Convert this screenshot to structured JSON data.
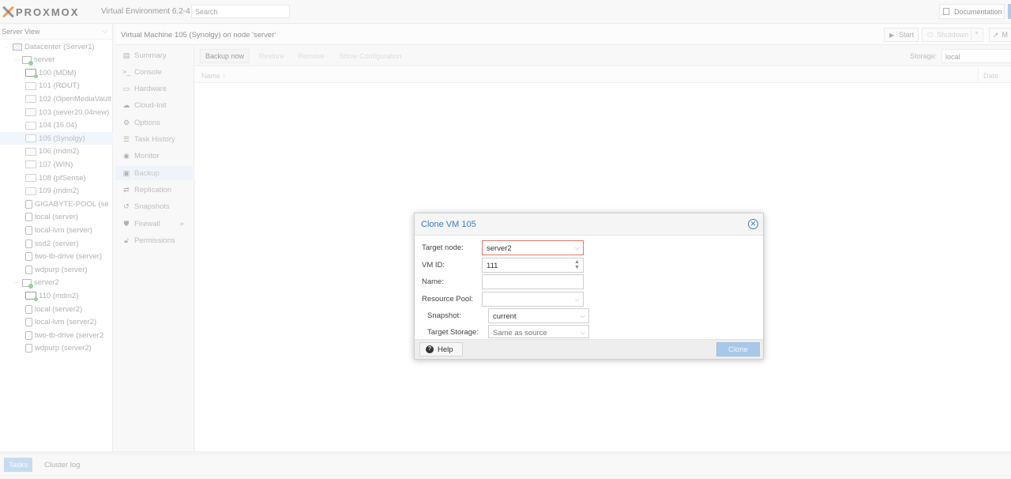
{
  "header": {
    "logo_text": "PROXMOX",
    "version": "Virtual Environment 6.2-4",
    "search_placeholder": "Search",
    "documentation_label": "Documentation"
  },
  "tree": {
    "view": "Server View",
    "nodes": [
      {
        "label": "Datacenter (Server1)",
        "icon": "datacenter-icon",
        "depth": 0
      },
      {
        "label": "server",
        "icon": "node-icon",
        "depth": 1
      },
      {
        "label": "100 (MDM)",
        "icon": "vm-running-icon",
        "depth": 2
      },
      {
        "label": "101 (ROUT)",
        "icon": "vm-icon",
        "depth": 2
      },
      {
        "label": "102 (OpenMediaVault",
        "icon": "vm-icon",
        "depth": 2
      },
      {
        "label": "103 (sever20.04new)",
        "icon": "vm-icon",
        "depth": 2
      },
      {
        "label": "104 (16.04)",
        "icon": "vm-icon",
        "depth": 2
      },
      {
        "label": "105 (Synolgy)",
        "icon": "vm-icon",
        "depth": 2,
        "selected": true
      },
      {
        "label": "106 (mdm2)",
        "icon": "vm-icon",
        "depth": 2
      },
      {
        "label": "107 (WIN)",
        "icon": "vm-icon",
        "depth": 2
      },
      {
        "label": "108 (pfSense)",
        "icon": "vm-icon",
        "depth": 2
      },
      {
        "label": "109 (mdm2)",
        "icon": "vm-icon",
        "depth": 2
      },
      {
        "label": "GIGABYTE-POOL (se",
        "icon": "storage-icon",
        "depth": 2
      },
      {
        "label": "local (server)",
        "icon": "storage-icon",
        "depth": 2
      },
      {
        "label": "local-lvm (server)",
        "icon": "storage-icon",
        "depth": 2
      },
      {
        "label": "ssd2 (server)",
        "icon": "storage-icon",
        "depth": 2
      },
      {
        "label": "two-tb-drive (server)",
        "icon": "storage-icon",
        "depth": 2
      },
      {
        "label": "wdpurp (server)",
        "icon": "storage-icon",
        "depth": 2
      },
      {
        "label": "server2",
        "icon": "node-icon",
        "depth": 1
      },
      {
        "label": "110 (mdm2)",
        "icon": "vm-running-icon",
        "depth": 2
      },
      {
        "label": "local (server2)",
        "icon": "storage-icon",
        "depth": 2
      },
      {
        "label": "local-lvm (server2)",
        "icon": "storage-icon",
        "depth": 2
      },
      {
        "label": "two-tb-drive (server2",
        "icon": "storage-icon",
        "depth": 2
      },
      {
        "label": "wdpurp (server2)",
        "icon": "storage-icon",
        "depth": 2
      }
    ]
  },
  "content": {
    "title": "Virtual Machine 105 (Synolgy) on node 'server'",
    "start_label": "Start",
    "shutdown_label": "Shutdown",
    "migrate_label": "M"
  },
  "menu": [
    {
      "label": "Summary",
      "icon": "book-icon"
    },
    {
      "label": "Console",
      "icon": "terminal-icon"
    },
    {
      "label": "Hardware",
      "icon": "monitor-icon"
    },
    {
      "label": "Cloud-Init",
      "icon": "cloud-icon"
    },
    {
      "label": "Options",
      "icon": "gear-icon"
    },
    {
      "label": "Task History",
      "icon": "list-icon"
    },
    {
      "label": "Monitor",
      "icon": "eye-icon"
    },
    {
      "label": "Backup",
      "icon": "floppy-icon",
      "selected": true
    },
    {
      "label": "Replication",
      "icon": "retweet-icon"
    },
    {
      "label": "Snapshots",
      "icon": "history-icon"
    },
    {
      "label": "Firewall",
      "icon": "shield-icon",
      "submenu": true
    },
    {
      "label": "Permissions",
      "icon": "unlock-icon"
    }
  ],
  "backup": {
    "buttons": [
      "Backup now",
      "Restore",
      "Remove",
      "Show Configuration"
    ],
    "storage_label": "Storage:",
    "storage_value": "local",
    "col_name": "Name",
    "col_date": "Date"
  },
  "bottom": {
    "tasks_label": "Tasks",
    "cluster_log_label": "Cluster log"
  },
  "dialog": {
    "title": "Clone VM 105",
    "target_node_label": "Target node:",
    "target_node_value": "server2",
    "vmid_label": "VM ID:",
    "vmid_value": "111",
    "name_label": "Name:",
    "name_value": "",
    "pool_label": "Resource Pool:",
    "pool_value": "",
    "snapshot_label": "Snapshot:",
    "snapshot_value": "current",
    "target_storage_label": "Target Storage:",
    "target_storage_value": "Same as source",
    "help_label": "Help",
    "clone_label": "Clone"
  },
  "colors": {
    "accent": "#3d7cc6",
    "logo_orange": "#e57000",
    "focus_border": "#e07b6b",
    "clone_button": "#a8c8e8"
  }
}
